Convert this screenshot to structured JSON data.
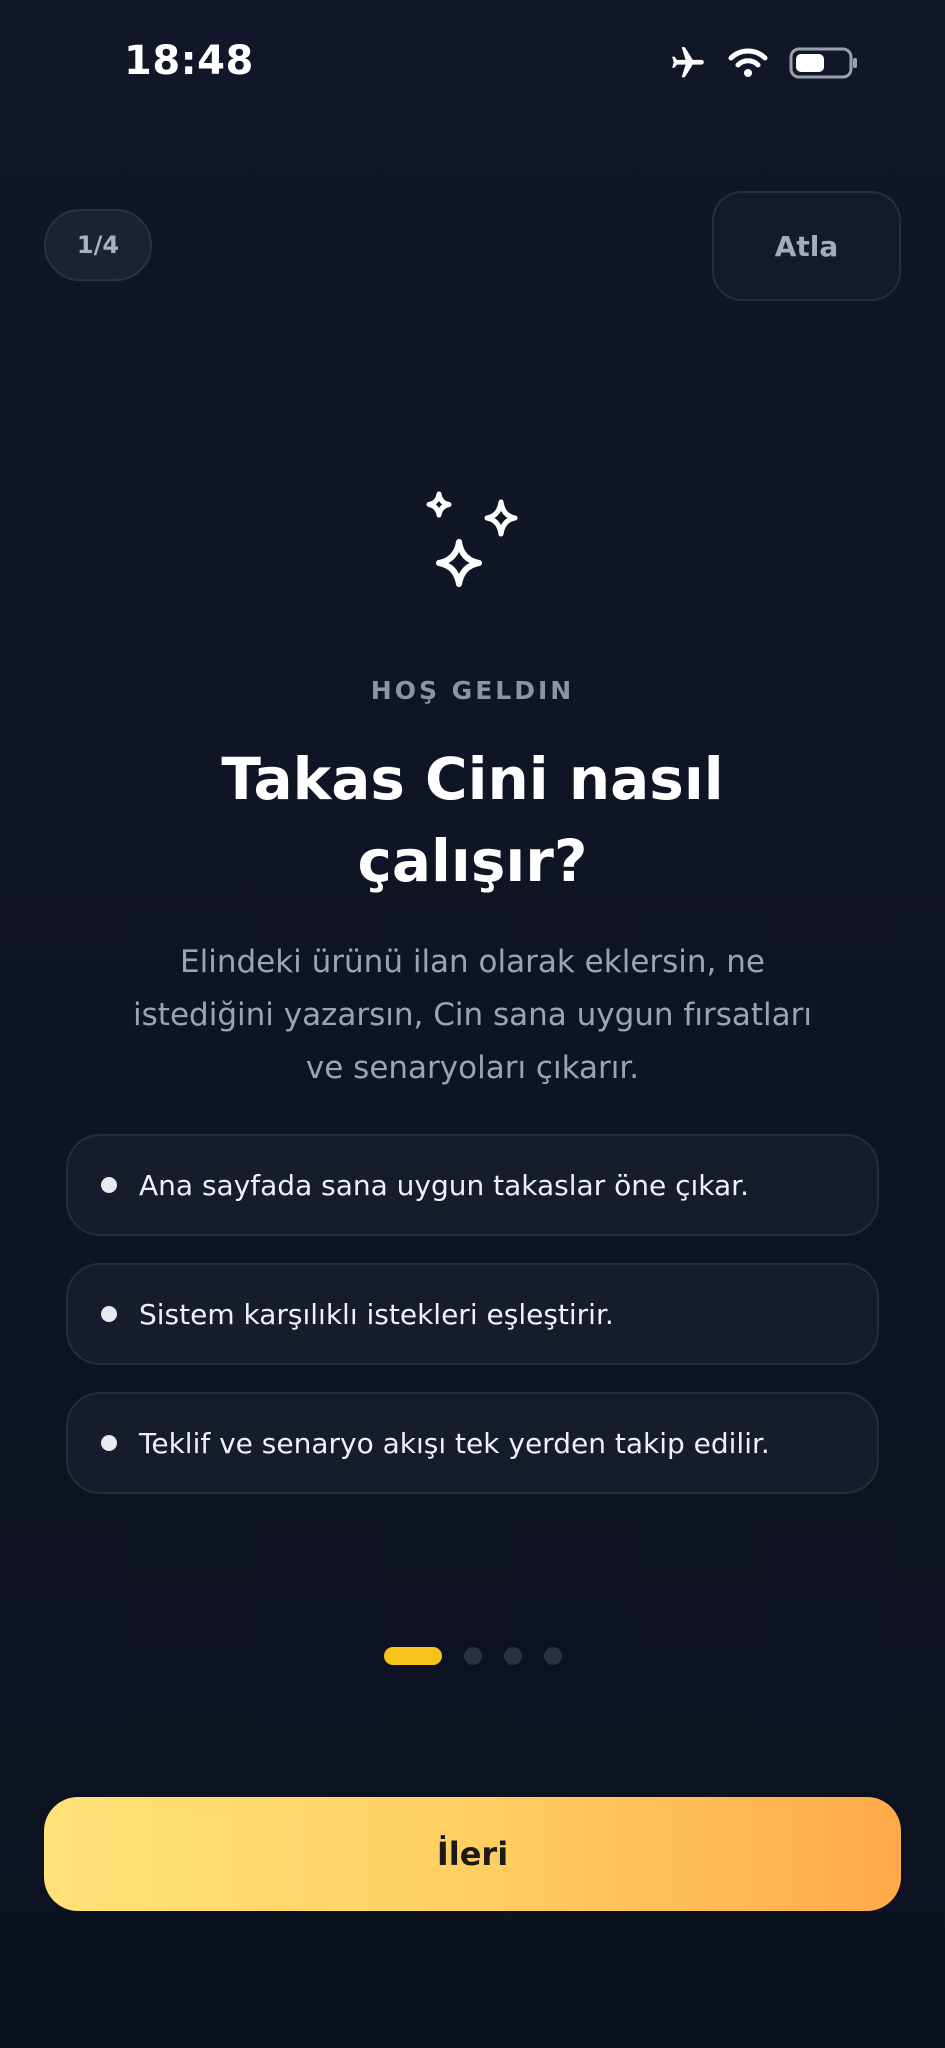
{
  "status_bar": {
    "time": "18:48",
    "icons": [
      "airplane-icon",
      "wifi-icon",
      "battery-icon"
    ]
  },
  "header": {
    "step_indicator": "1/4",
    "skip_label": "Atla"
  },
  "hero": {
    "icon": "sparkles-icon",
    "eyebrow": "HOŞ GELDIN",
    "title": "Takas Cini nasıl çalışır?",
    "subtitle": "Elindeki ürünü ilan olarak eklersin, ne istediğini yazarsın, Cin sana uygun fırsatları ve senaryoları çıkarır."
  },
  "features": [
    {
      "text": "Ana sayfada sana uygun takaslar öne çıkar."
    },
    {
      "text": "Sistem karşılıklı istekleri eşleştirir."
    },
    {
      "text": "Teklif ve senaryo akışı tek yerden takip edilir."
    }
  ],
  "pagination": {
    "current_page": 1,
    "total_pages": 4
  },
  "cta": {
    "next_label": "İleri"
  },
  "colors": {
    "background": "#0f1424",
    "accent_yellow": "#f7c21a",
    "button_gradient_start": "#ffe278",
    "button_gradient_end": "#ffaa48"
  }
}
